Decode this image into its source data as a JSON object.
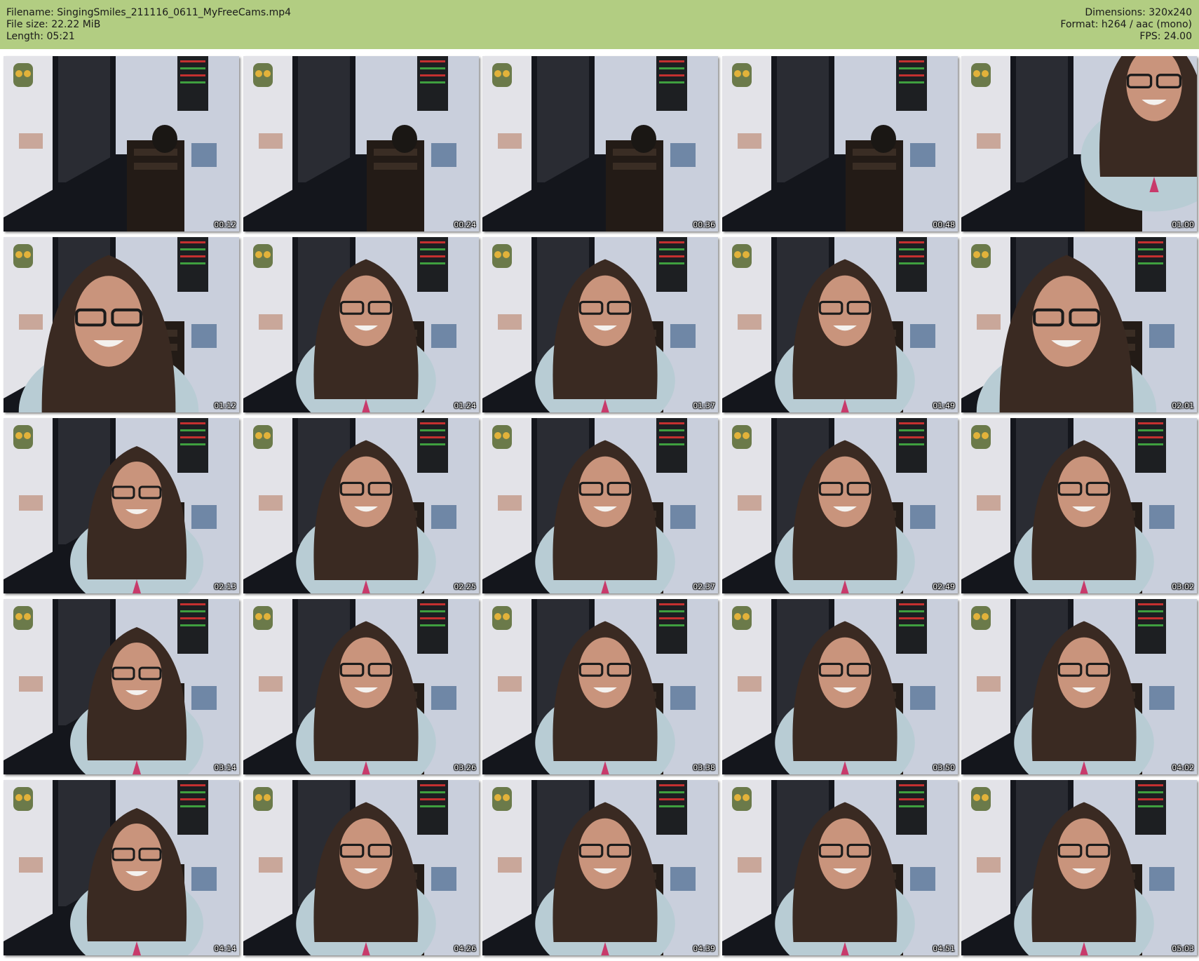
{
  "header": {
    "filename": "Filename: SingingSmiles_211116_0611_MyFreeCams.mp4",
    "filesize": "File size: 22.22 MiB",
    "length": "Length: 05:21",
    "dimensions": "Dimensions: 320x240",
    "format": "Format: h264 / aac (mono)",
    "fps": "FPS: 24.00"
  },
  "colors": {
    "header_bg": "#b2cd82",
    "wall": "#c9cfdc",
    "dark": "#14161c",
    "hair": "#3a2a22",
    "shirt": "#b8ccd4",
    "skin": "#c9947c"
  },
  "thumbnails": [
    {
      "time": "00:12",
      "person": "none"
    },
    {
      "time": "00:24",
      "person": "none"
    },
    {
      "time": "00:36",
      "person": "none"
    },
    {
      "time": "00:48",
      "person": "none"
    },
    {
      "time": "01:00",
      "person": "entering"
    },
    {
      "time": "01:12",
      "person": "close"
    },
    {
      "time": "01:24",
      "person": "center"
    },
    {
      "time": "01:37",
      "person": "center"
    },
    {
      "time": "01:49",
      "person": "center"
    },
    {
      "time": "02:01",
      "person": "close"
    },
    {
      "time": "02:13",
      "person": "left"
    },
    {
      "time": "02:25",
      "person": "center"
    },
    {
      "time": "02:37",
      "person": "center"
    },
    {
      "time": "02:49",
      "person": "center"
    },
    {
      "time": "03:02",
      "person": "center"
    },
    {
      "time": "03:14",
      "person": "left"
    },
    {
      "time": "03:26",
      "person": "center"
    },
    {
      "time": "03:38",
      "person": "center"
    },
    {
      "time": "03:50",
      "person": "center"
    },
    {
      "time": "04:02",
      "person": "center"
    },
    {
      "time": "04:14",
      "person": "left"
    },
    {
      "time": "04:26",
      "person": "center"
    },
    {
      "time": "04:39",
      "person": "center"
    },
    {
      "time": "04:51",
      "person": "center"
    },
    {
      "time": "05:03",
      "person": "center"
    }
  ]
}
